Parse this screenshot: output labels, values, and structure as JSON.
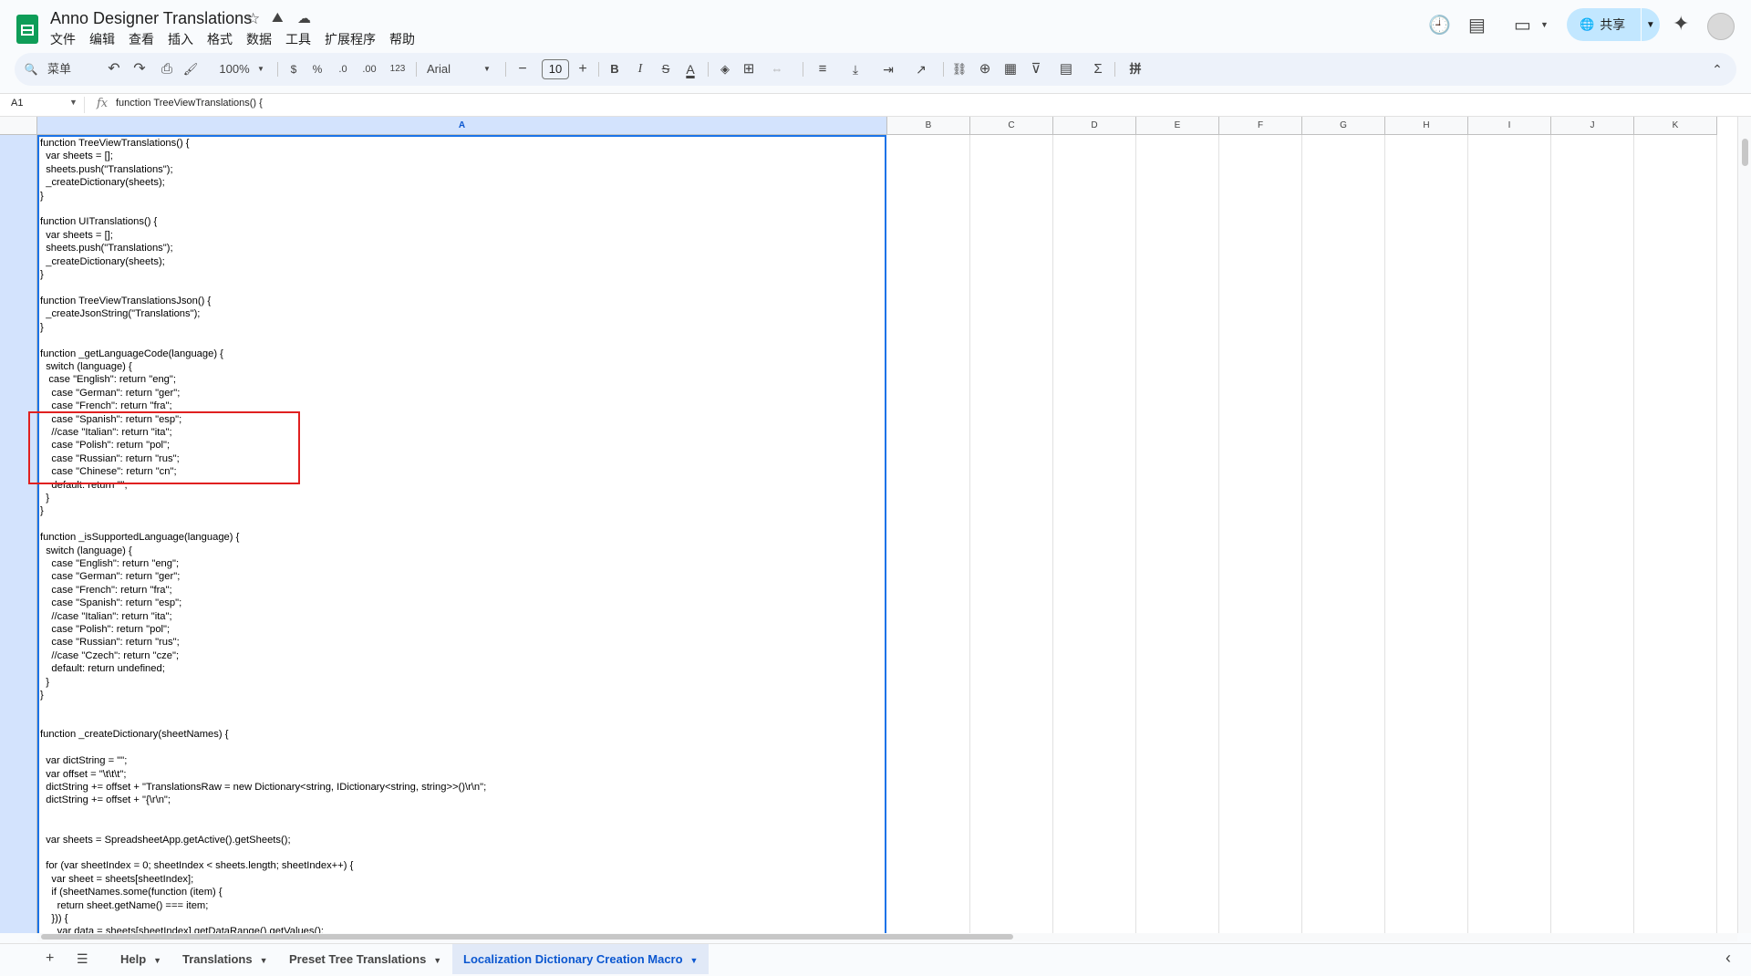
{
  "window": {
    "doc_title": "Anno Designer Translations",
    "menu": [
      "文件",
      "编辑",
      "查看",
      "插入",
      "格式",
      "数据",
      "工具",
      "扩展程序",
      "帮助"
    ],
    "share_label": "共享",
    "icons": {
      "star": "☆",
      "drive": "⛰",
      "cloud": "☁",
      "history": "🕘",
      "comment": "▤",
      "meet": "▭",
      "gemini": "✦",
      "globe": "🌐"
    }
  },
  "toolbar": {
    "search_label": "菜单",
    "zoom": "100%",
    "currency": "$",
    "percent": "%",
    "dec_decrease": ".0",
    "dec_increase": ".00",
    "number_format": "123",
    "font": "Arial",
    "font_size": "10",
    "minus": "−",
    "plus": "+",
    "bold": "B",
    "italic": "I",
    "strike": "S",
    "text_color": "A",
    "sigma": "Σ",
    "icons": {
      "search": "🔍",
      "undo": "↶",
      "redo": "↷",
      "print": "⎙",
      "paint_format": "🖌",
      "fill": "◈",
      "borders": "⊞",
      "merge": "⇔",
      "align": "≡",
      "valign": "⤓",
      "wrap": "⇥",
      "rotate": "↗",
      "link": "⛓",
      "comment": "⊕",
      "chart": "▦",
      "filter": "⊽",
      "filter_views": "▤",
      "input_tools": "拼",
      "collapse": "⌃"
    }
  },
  "formula_bar": {
    "cell_ref": "A1",
    "fx": "fx",
    "content": "function TreeViewTranslations() {"
  },
  "grid": {
    "columns": [
      "A",
      "B",
      "C",
      "D",
      "E",
      "F",
      "G",
      "H",
      "I",
      "J",
      "K"
    ],
    "selected_column": "A",
    "cell_a1": "function TreeViewTranslations() {\n  var sheets = [];\n  sheets.push(\"Translations\");\n  _createDictionary(sheets);\n}\n\nfunction UITranslations() {\n  var sheets = [];\n  sheets.push(\"Translations\");\n  _createDictionary(sheets);\n}\n\nfunction TreeViewTranslationsJson() {\n  _createJsonString(\"Translations\");\n}\n\nfunction _getLanguageCode(language) {\n  switch (language) {\n   case \"English\": return \"eng\";\n    case \"German\": return \"ger\";\n    case \"French\": return \"fra\";\n    case \"Spanish\": return \"esp\";\n    //case \"Italian\": return \"ita\";\n    case \"Polish\": return \"pol\";\n    case \"Russian\": return \"rus\";\n    case \"Chinese\": return \"cn\";\n    default: return \"\";\n  }\n}\n\nfunction _isSupportedLanguage(language) {\n  switch (language) {\n    case \"English\": return \"eng\";\n    case \"German\": return \"ger\";\n    case \"French\": return \"fra\";\n    case \"Spanish\": return \"esp\";\n    //case \"Italian\": return \"ita\";\n    case \"Polish\": return \"pol\";\n    case \"Russian\": return \"rus\";\n    //case \"Czech\": return \"cze\";\n    default: return undefined;\n  }\n}\n\n\nfunction _createDictionary(sheetNames) {\n\n  var dictString = \"\";\n  var offset = \"\\t\\t\\t\";\n  dictString += offset + \"TranslationsRaw = new Dictionary<string, IDictionary<string, string>>()\\r\\n\";\n  dictString += offset + \"{\\r\\n\";\n\n\n  var sheets = SpreadsheetApp.getActive().getSheets();\n\n  for (var sheetIndex = 0; sheetIndex < sheets.length; sheetIndex++) {\n    var sheet = sheets[sheetIndex];\n    if (sheetNames.some(function (item) {\n      return sheet.getName() === item;\n    })) {\n      var data = sheets[sheetIndex].getDataRange().getValues();"
  },
  "sheet_tabs": {
    "add_icon": "+",
    "all_sheets_icon": "☰",
    "tabs": [
      "Help",
      "Translations",
      "Preset Tree Translations",
      "Localization Dictionary Creation Macro"
    ],
    "active": "Localization Dictionary Creation Macro",
    "collapse_icon": "‹"
  },
  "colors": {
    "accent": "#0b57d0",
    "share_bg": "#c2e7ff",
    "selection": "#1a73e8",
    "annotation": "#e02020",
    "sheets_green": "#0f9d58"
  }
}
